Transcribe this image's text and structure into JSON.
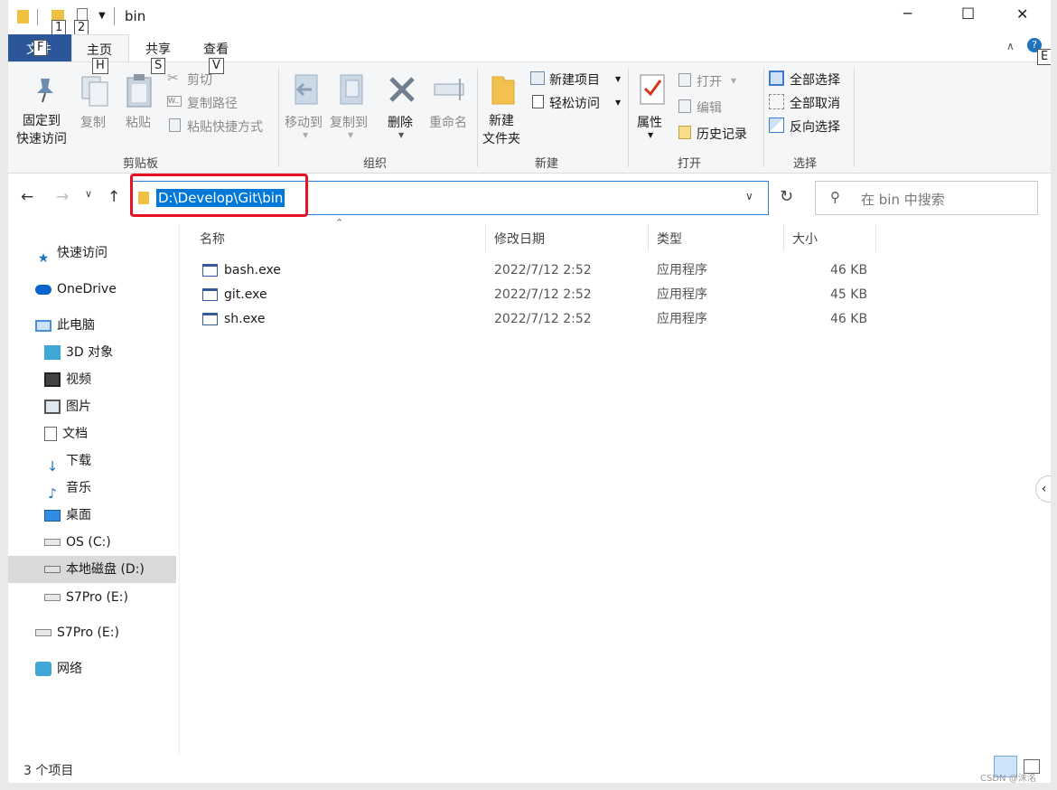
{
  "window": {
    "title": "bin",
    "qat_keytips": [
      "1",
      "2"
    ],
    "controls": {
      "minimize": "─",
      "maximize": "☐",
      "close": "✕"
    }
  },
  "tabs": [
    {
      "label": "文件",
      "keytip": "F"
    },
    {
      "label": "主页",
      "keytip": "H"
    },
    {
      "label": "共享",
      "keytip": "S"
    },
    {
      "label": "查看",
      "keytip": "V"
    }
  ],
  "help_keytip": "E",
  "ribbon": {
    "clipboard": {
      "label": "剪贴板",
      "pin": "固定到\n快速访问",
      "pin_line1": "固定到",
      "pin_line2": "快速访问",
      "copy": "复制",
      "paste": "粘贴",
      "cut": "剪切",
      "copy_path": "复制路径",
      "paste_shortcut": "粘贴快捷方式"
    },
    "organize": {
      "label": "组织",
      "move_to": "移动到",
      "copy_to": "复制到",
      "delete": "删除",
      "rename": "重命名"
    },
    "new": {
      "label": "新建",
      "new_folder_line1": "新建",
      "new_folder_line2": "文件夹",
      "new_item": "新建项目",
      "easy_access": "轻松访问"
    },
    "open": {
      "label": "打开",
      "properties": "属性",
      "open": "打开",
      "edit": "编辑",
      "history": "历史记录"
    },
    "select": {
      "label": "选择",
      "select_all": "全部选择",
      "select_none": "全部取消",
      "invert": "反向选择"
    }
  },
  "address": {
    "path": "D:\\Develop\\Git\\bin",
    "search_placeholder": "在 bin 中搜索"
  },
  "nav": [
    {
      "label": "快速访问",
      "icon": "star-icon"
    },
    {
      "label": "OneDrive",
      "icon": "cloud-icon"
    },
    {
      "label": "此电脑",
      "icon": "computer-icon"
    },
    {
      "label": "3D 对象",
      "icon": "cube-icon"
    },
    {
      "label": "视频",
      "icon": "video-icon"
    },
    {
      "label": "图片",
      "icon": "picture-icon"
    },
    {
      "label": "文档",
      "icon": "document-icon"
    },
    {
      "label": "下载",
      "icon": "download-icon"
    },
    {
      "label": "音乐",
      "icon": "music-icon"
    },
    {
      "label": "桌面",
      "icon": "desktop-icon"
    },
    {
      "label": "OS (C:)",
      "icon": "drive-icon"
    },
    {
      "label": "本地磁盘 (D:)",
      "icon": "drive-icon"
    },
    {
      "label": "S7Pro (E:)",
      "icon": "drive-icon"
    },
    {
      "label": "S7Pro (E:)",
      "icon": "drive-icon"
    },
    {
      "label": "网络",
      "icon": "network-icon"
    }
  ],
  "columns": {
    "name": "名称",
    "date": "修改日期",
    "type": "类型",
    "size": "大小"
  },
  "files": [
    {
      "name": "bash.exe",
      "date": "2022/7/12 2:52",
      "type": "应用程序",
      "size": "46 KB"
    },
    {
      "name": "git.exe",
      "date": "2022/7/12 2:52",
      "type": "应用程序",
      "size": "45 KB"
    },
    {
      "name": "sh.exe",
      "date": "2022/7/12 2:52",
      "type": "应用程序",
      "size": "46 KB"
    }
  ],
  "status": {
    "count": "3 个项目"
  },
  "watermark": "CSDN @沫洺",
  "colors": {
    "selection": "#0078d7",
    "highlight_border": "#e81123",
    "file_tab": "#2b579a"
  }
}
